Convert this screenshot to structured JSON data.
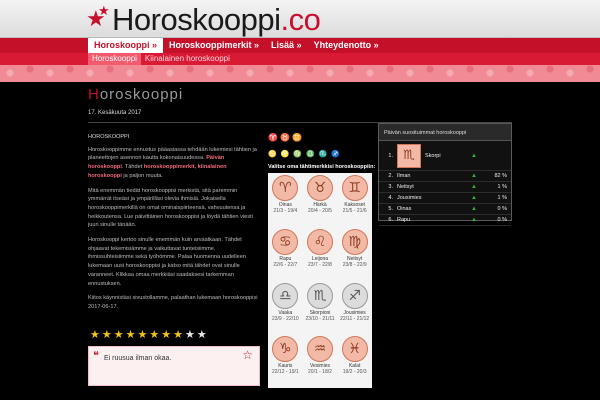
{
  "brand": {
    "name": "Horoskooppi",
    "domain": ".co"
  },
  "nav": [
    {
      "label": "Horoskooppi »",
      "active": true
    },
    {
      "label": "Horoskooppimerkit »",
      "active": false
    },
    {
      "label": "Lisää »",
      "active": false
    },
    {
      "label": "Yhteydenotto »",
      "active": false
    }
  ],
  "subnav": [
    {
      "label": "Horoskooppi",
      "active": true
    },
    {
      "label": "Kiinalainen horoskooppi",
      "active": false
    }
  ],
  "main": {
    "title_first": "H",
    "title_rest": "oroskooppi",
    "date": "17. Kesäkuuta 2017",
    "article_title": "HOROSKOOPPI",
    "para1_a": "Horoskooppimme ennustus pääasiassa tehdään lukemiesi tähtien ja planeettojen asennon kautta kokonaisuudessa. ",
    "para1_hl1": "Päivän horoskooppi",
    "para1_b": ". Tähdet ",
    "para1_hl2": "horoskooppimerkit, kiinalainen horoskooppi",
    "para1_c": " ja paljon muuta.",
    "para2": "Mitä enemmän tiedät horoskooppisi merkistä, sitä paremmin ymmärrät itseäsi ja ympärilläsi olevia ihmisiä. Jokaisella horoskooppimerkillä on omat ominaispiirteensä, vahvuutensa ja heikkoutensa. Lue päivittäinen horoskooppisi ja löydä tähtien viesti juuri sinulle tänään.",
    "para3": "Horoskooppi kertoo sinulle enemmän kuin arvaatkaan. Tähdet ohjaavat tekemisiämme ja vaikuttavat tunteisiimme, ihmissuhteisiimme sekä työhömme. Palaa huomenna uudelleen lukemaan uusi horoskooppisi ja katso mitä tähdet ovat sinulle varanneet. Klikkaa omaa merkkiäsi saadaksesi tarkemman ennustuksen.",
    "para4": "Kiitos käynnistäsi sivustollamme, palaathan lukemaan horoskooppisi 2017-06-17.",
    "rating": 8,
    "rating_max": 10,
    "quote": "Ei ruusua ilman okaa."
  },
  "zodiac": {
    "heading1": "♈ ♉ ♊",
    "heading2": "♋ ♌ ♍ ♎ ♏ ♐",
    "lead": "Valitse oma tähtimerkkisi horoskooppiin:",
    "signs": [
      {
        "name": "Oinas",
        "dates": "21/3 - 19/4",
        "glyph": "♈",
        "highlight": true
      },
      {
        "name": "Härkä",
        "dates": "20/4 - 20/5",
        "glyph": "♉",
        "highlight": true
      },
      {
        "name": "Kaksoset",
        "dates": "21/5 - 21/6",
        "glyph": "♊",
        "highlight": true
      },
      {
        "name": "Rapu",
        "dates": "22/6 - 22/7",
        "glyph": "♋",
        "highlight": true
      },
      {
        "name": "Leijona",
        "dates": "23/7 - 22/8",
        "glyph": "♌",
        "highlight": true
      },
      {
        "name": "Neitsyt",
        "dates": "23/8 - 22/9",
        "glyph": "♍",
        "highlight": true
      },
      {
        "name": "Vaaka",
        "dates": "23/9 - 22/10",
        "glyph": "♎",
        "highlight": false
      },
      {
        "name": "Skorpioni",
        "dates": "23/10 - 21/11",
        "glyph": "♏",
        "highlight": false
      },
      {
        "name": "Jousimies",
        "dates": "22/11 - 21/12",
        "glyph": "♐",
        "highlight": false
      },
      {
        "name": "Kauris",
        "dates": "22/12 - 19/1",
        "glyph": "♑",
        "highlight": true
      },
      {
        "name": "Vesimies",
        "dates": "20/1 - 18/2",
        "glyph": "♒",
        "highlight": true
      },
      {
        "name": "Kalat",
        "dates": "19/2 - 20/3",
        "glyph": "♓",
        "highlight": true
      }
    ]
  },
  "ranking": {
    "header": "Päivän suosituimmat horoskooppi",
    "rows": [
      {
        "rank": "1.",
        "name": "Skorpi",
        "pct": "",
        "arrow": "▲",
        "top": true
      },
      {
        "rank": "2.",
        "name": "Ilman",
        "pct": "82 %",
        "arrow": "▲",
        "top": false
      },
      {
        "rank": "3.",
        "name": "Neitsyt",
        "pct": "1 %",
        "arrow": "▲",
        "top": false
      },
      {
        "rank": "4.",
        "name": "Jousimies",
        "pct": "1 %",
        "arrow": "▲",
        "top": false
      },
      {
        "rank": "5.",
        "name": "Oinas",
        "pct": "0 %",
        "arrow": "▲",
        "top": false
      },
      {
        "rank": "6.",
        "name": "Rapu",
        "pct": "0 %",
        "arrow": "▲",
        "top": false
      }
    ]
  },
  "colors": {
    "brand_red": "#c5102a",
    "band_pink": "#f08a95",
    "star_yellow": "#f3c418"
  },
  "icons": {
    "logo": "star-icon",
    "quote": "quote-icon",
    "rating": "star-icon",
    "arrow": "arrow-up-icon"
  }
}
